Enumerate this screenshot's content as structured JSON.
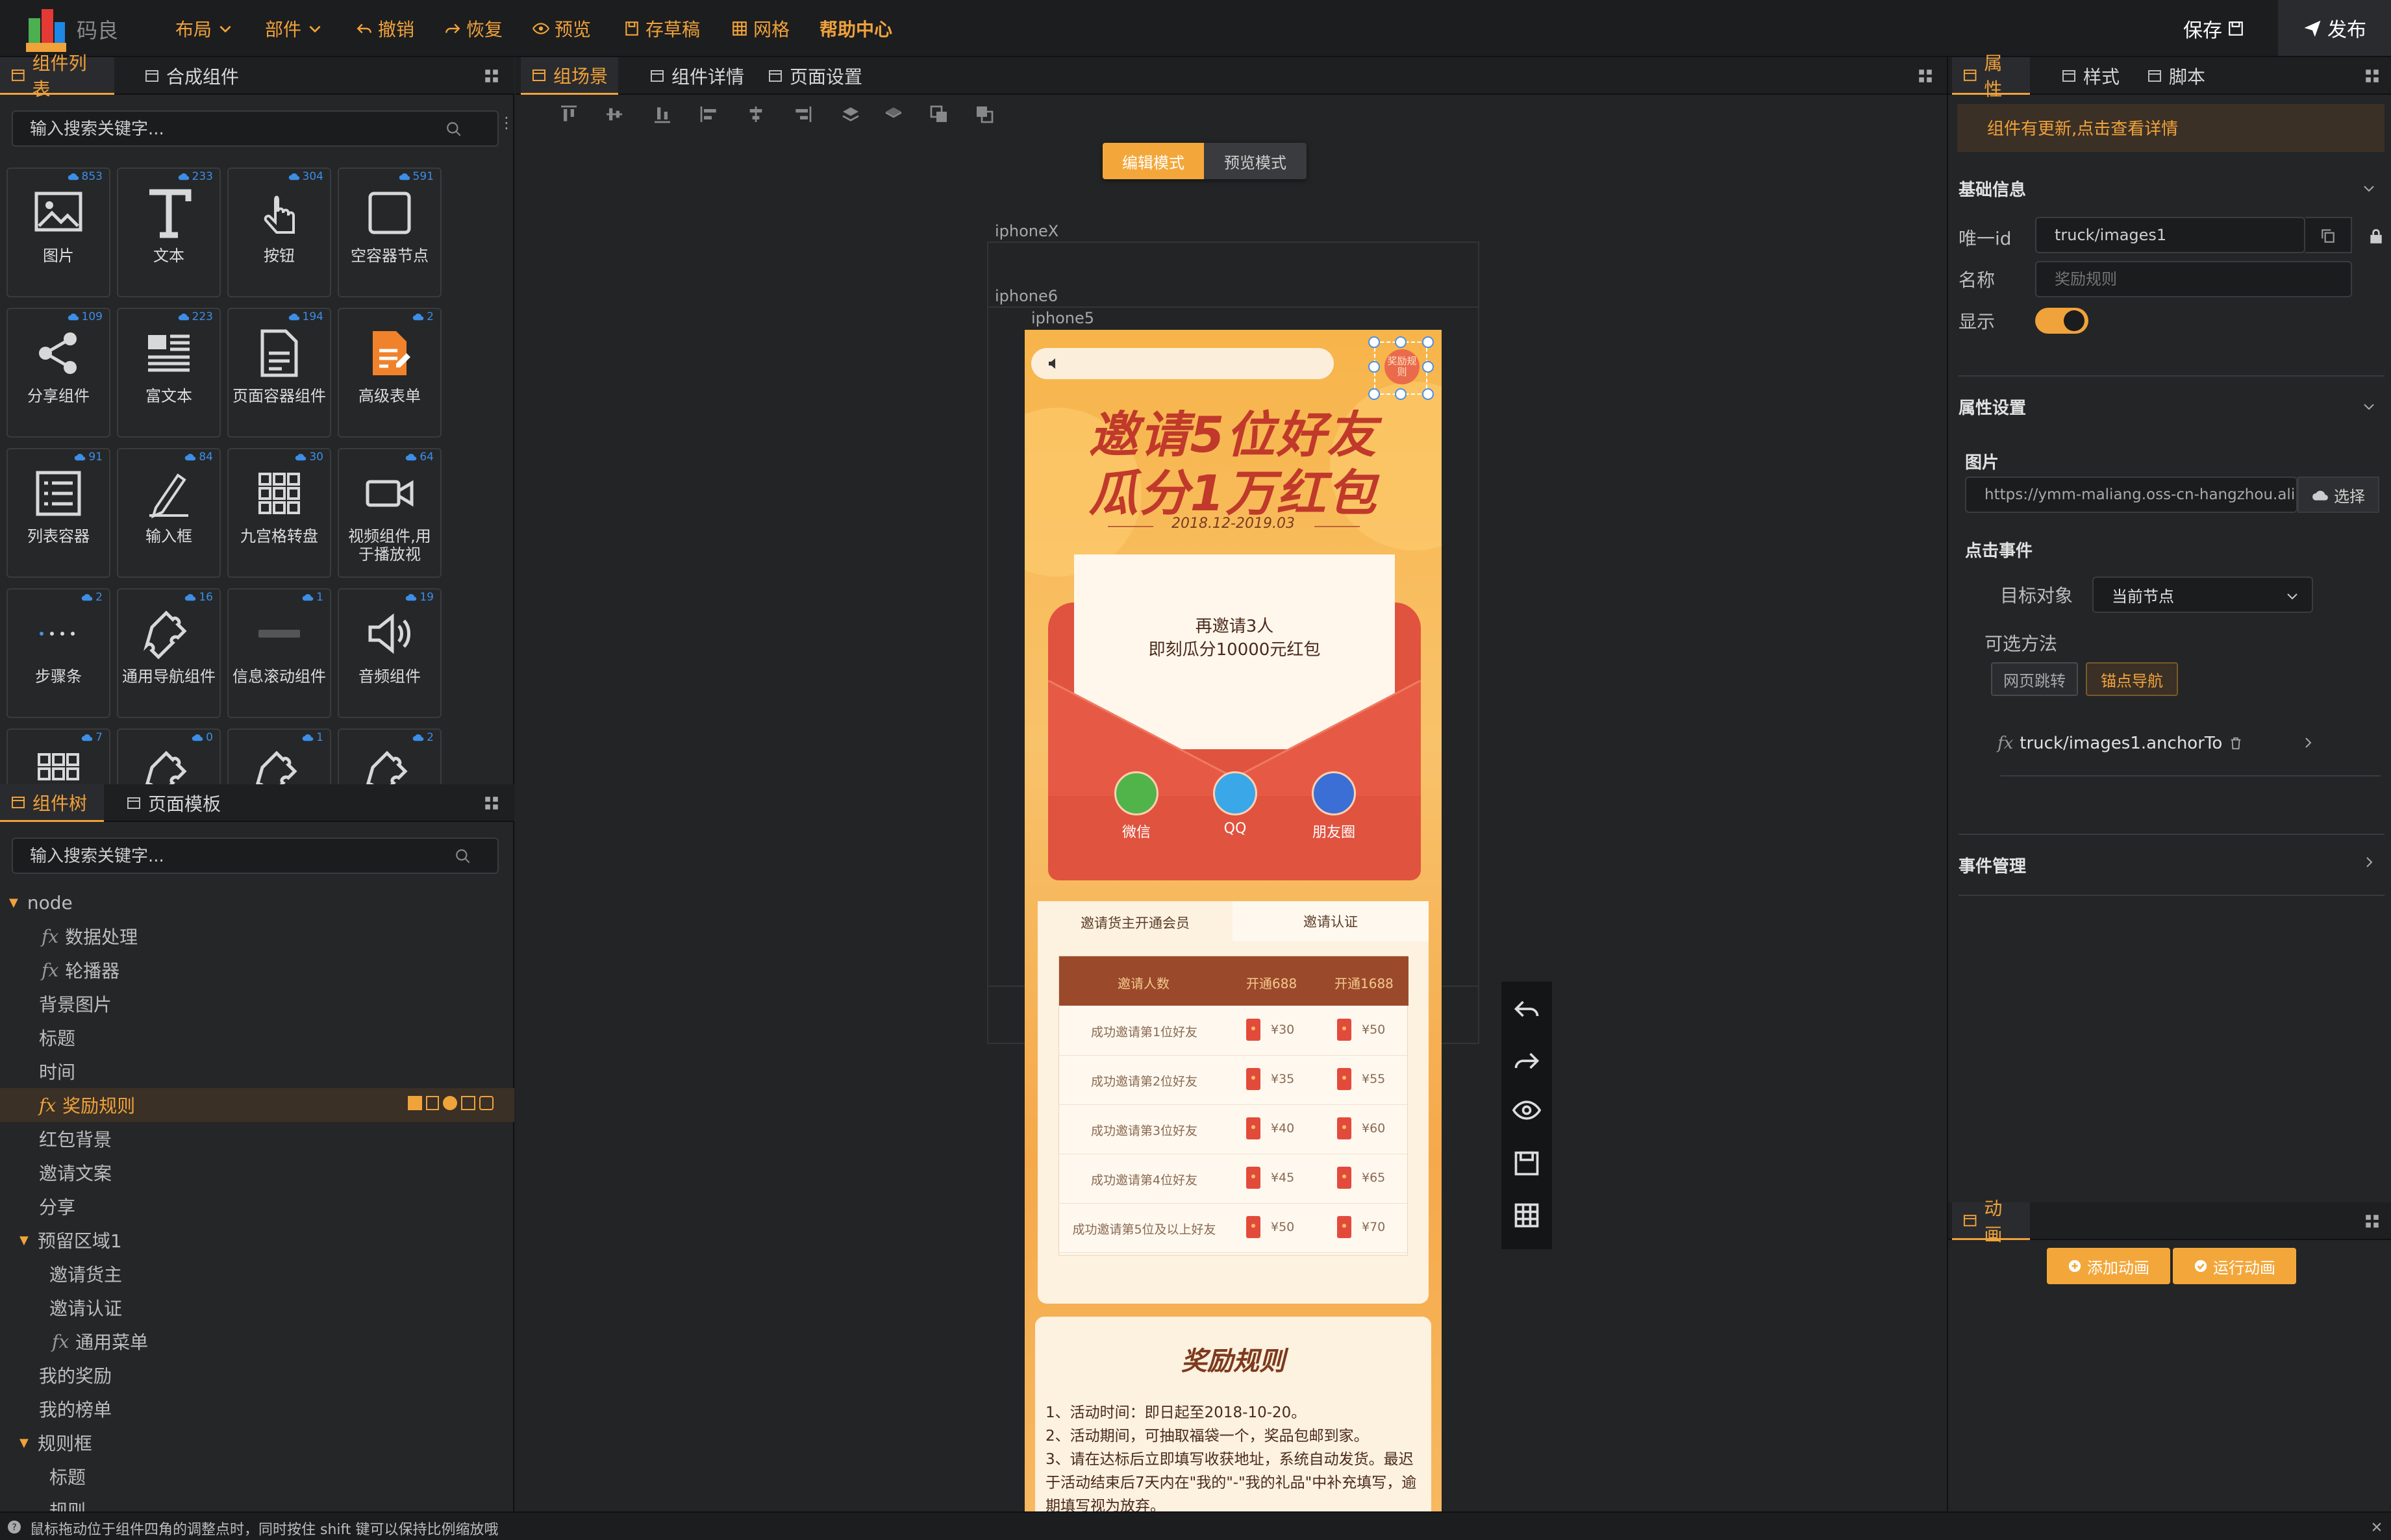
{
  "topbar": {
    "logo_text": "码良",
    "menus": [
      {
        "label": "布局",
        "icon": "chevron-down-icon"
      },
      {
        "label": "部件",
        "icon": "chevron-down-icon"
      },
      {
        "label": "撤销",
        "icon": "undo-icon"
      },
      {
        "label": "恢复",
        "icon": "redo-icon"
      },
      {
        "label": "预览",
        "icon": "eye-icon"
      },
      {
        "label": "存草稿",
        "icon": "draft-icon"
      },
      {
        "label": "网格",
        "icon": "grid-icon"
      },
      {
        "label": "帮助中心",
        "icon": ""
      }
    ],
    "save_label": "保存",
    "publish_label": "发布",
    "accent": "#f0a23b"
  },
  "left": {
    "tabs": [
      "组件列表",
      "合成组件"
    ],
    "search_placeholder": "输入搜索关键字...",
    "components": [
      {
        "label": "图片",
        "count": "853",
        "icon": "image-icon"
      },
      {
        "label": "文本",
        "count": "233",
        "icon": "text-icon"
      },
      {
        "label": "按钮",
        "count": "304",
        "icon": "hand-pointer-icon"
      },
      {
        "label": "空容器节点",
        "count": "591",
        "icon": "container-icon"
      },
      {
        "label": "分享组件",
        "count": "109",
        "icon": "share-icon"
      },
      {
        "label": "富文本",
        "count": "223",
        "icon": "richtext-icon"
      },
      {
        "label": "页面容器组件",
        "count": "194",
        "icon": "page-icon"
      },
      {
        "label": "高级表单",
        "count": "2",
        "icon": "form-icon"
      },
      {
        "label": "列表容器",
        "count": "91",
        "icon": "list-icon"
      },
      {
        "label": "输入框",
        "count": "84",
        "icon": "pen-icon"
      },
      {
        "label": "九宫格转盘",
        "count": "30",
        "icon": "nine-grid-icon"
      },
      {
        "label": "视频组件,用于播放视",
        "count": "64",
        "icon": "video-icon"
      },
      {
        "label": "步骤条",
        "count": "2",
        "icon": "steps-icon"
      },
      {
        "label": "通用导航组件",
        "count": "16",
        "icon": "puzzle-icon"
      },
      {
        "label": "信息滚动组件",
        "count": "1",
        "icon": "marquee-icon"
      },
      {
        "label": "音频组件",
        "count": "19",
        "icon": "audio-icon"
      },
      {
        "label": "",
        "count": "7",
        "icon": "grid-icon"
      },
      {
        "label": "",
        "count": "0",
        "icon": "puzzle-icon"
      },
      {
        "label": "",
        "count": "1",
        "icon": "puzzle-icon"
      },
      {
        "label": "",
        "count": "2",
        "icon": "puzzle-icon"
      }
    ],
    "tree_tabs": [
      "组件树",
      "页面模板"
    ],
    "tree_search_placeholder": "输入搜索关键字...",
    "tree": [
      {
        "label": "node",
        "fx": false,
        "caret": true
      },
      {
        "label": "数据处理",
        "fx": true
      },
      {
        "label": "轮播器",
        "fx": true
      },
      {
        "label": "背景图片",
        "fx": false
      },
      {
        "label": "标题",
        "fx": false
      },
      {
        "label": "时间",
        "fx": false
      },
      {
        "label": "奖励规则",
        "fx": true,
        "selected": true
      },
      {
        "label": "红包背景",
        "fx": false
      },
      {
        "label": "邀请文案",
        "fx": false
      },
      {
        "label": "分享",
        "fx": false
      },
      {
        "label": "预留区域1",
        "fx": false,
        "caret": true
      },
      {
        "label": "邀请货主",
        "fx": false
      },
      {
        "label": "邀请认证",
        "fx": false
      },
      {
        "label": "通用菜单",
        "fx": true
      },
      {
        "label": "我的奖励",
        "fx": false
      },
      {
        "label": "我的榜单",
        "fx": false
      },
      {
        "label": "规则框",
        "fx": false,
        "caret": true
      },
      {
        "label": "标题",
        "fx": false
      },
      {
        "label": "规则",
        "fx": false
      }
    ]
  },
  "center": {
    "tabs": [
      "组场景",
      "组件详情",
      "页面设置"
    ],
    "mode_edit": "编辑模式",
    "mode_preview": "预览模式",
    "device_labels": [
      "iphoneX",
      "iphone6",
      "iphone5"
    ]
  },
  "phone": {
    "title_line1": "邀请5位好友",
    "title_line2": "瓜分1万红包",
    "date": "2018.12-2019.03",
    "rule_badge": "奖励规则",
    "invite_line1": "再邀请3人",
    "invite_line2": "即刻瓜分10000元红包",
    "share": [
      "微信",
      "QQ",
      "朋友圈"
    ],
    "tabs": [
      "邀请货主开通会员",
      "邀请认证"
    ],
    "table_headers": [
      "邀请人数",
      "开通688",
      "开通1688"
    ],
    "table_rows": [
      [
        "成功邀请第1位好友",
        "¥30",
        "¥50"
      ],
      [
        "成功邀请第2位好友",
        "¥35",
        "¥55"
      ],
      [
        "成功邀请第3位好友",
        "¥40",
        "¥60"
      ],
      [
        "成功邀请第4位好友",
        "¥45",
        "¥65"
      ],
      [
        "成功邀请第5位及以上好友",
        "¥50",
        "¥70"
      ]
    ],
    "rules_title": "奖励规则",
    "rules": [
      "1、活动时间：即日起至2018-10-20。",
      "2、活动期间，可抽取福袋一个，奖品包邮到家。",
      "3、请在达标后立即填写收获地址，系统自动发货。最迟于活动结束后7天内在\"我的\"-\"我的礼品\"中补充填写，逾期填写视为放弃。"
    ]
  },
  "right": {
    "tabs": [
      "属性",
      "样式",
      "脚本"
    ],
    "notice": "组件有更新,点击查看详情",
    "basic_info": "基础信息",
    "id_label": "唯一id",
    "id_value": "truck/images1",
    "name_label": "名称",
    "name_placeholder": "奖励规则",
    "visible_label": "显示",
    "attr_settings": "属性设置",
    "image_label": "图片",
    "image_value": "https://ymm-maliang.oss-cn-hangzhou.ali",
    "choose_label": "选择",
    "click_event": "点击事件",
    "target_label": "目标对象",
    "target_value": "当前节点",
    "methods_label": "可选方法",
    "methods": [
      "网页跳转",
      "锚点导航"
    ],
    "fx_method": "truck/images1.anchorTo",
    "event_mgmt": "事件管理",
    "anim_tab": "动画",
    "add_anim": "添加动画",
    "run_anim": "运行动画"
  },
  "status": {
    "tip": "鼠标拖动位于组件四角的调整点时，同时按住 shift 键可以保持比例缩放哦"
  }
}
